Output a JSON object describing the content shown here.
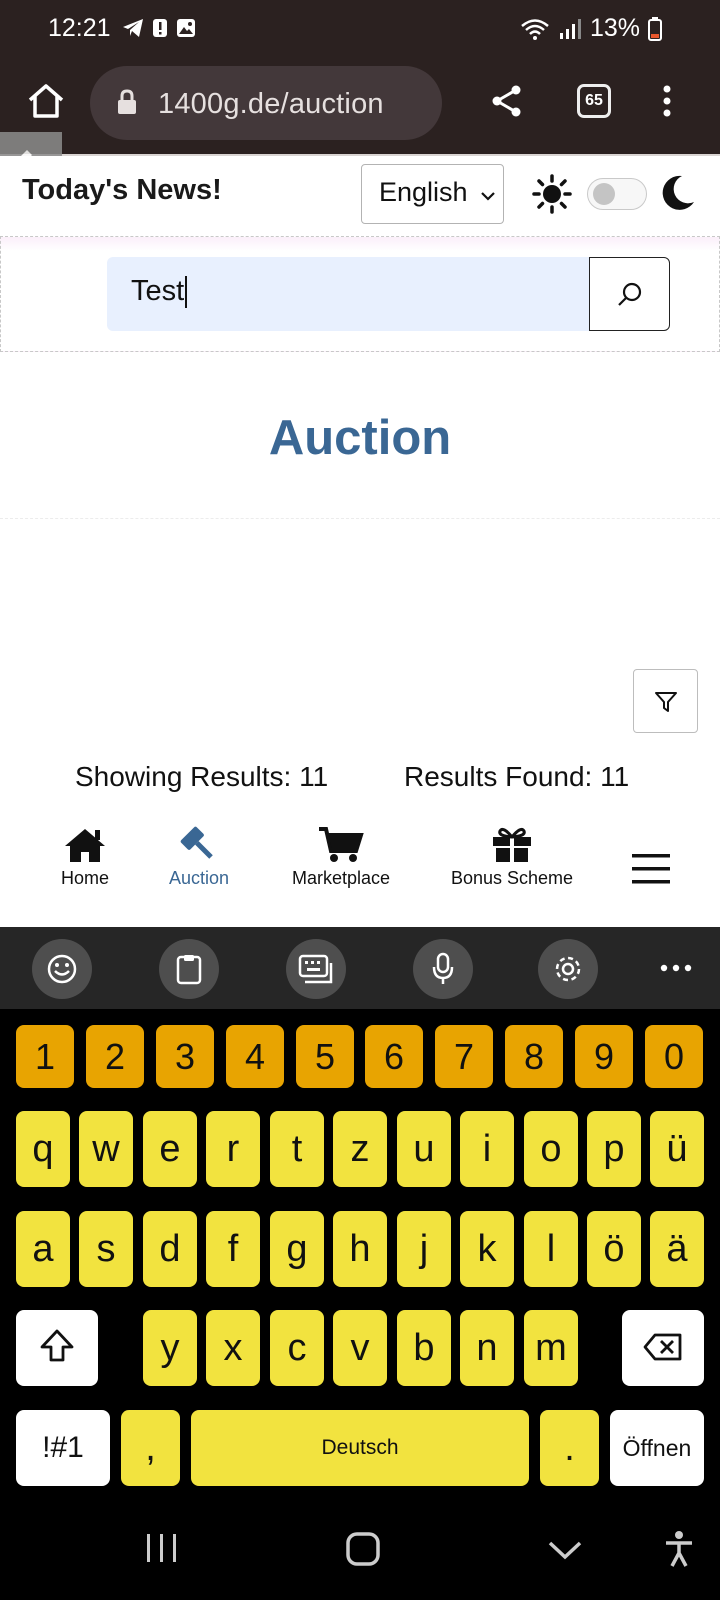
{
  "status_bar": {
    "time": "12:21",
    "battery": "13%"
  },
  "browser": {
    "url": "1400g.de/auction",
    "tab_count": "65"
  },
  "header": {
    "title": "Today's News!",
    "language": "English"
  },
  "search": {
    "value": "Test"
  },
  "page": {
    "title": "Auction"
  },
  "results": {
    "showing": "Showing Results: 11",
    "found": "Results Found: 11"
  },
  "nav": {
    "items": [
      {
        "label": "Home",
        "icon": "home-icon"
      },
      {
        "label": "Auction",
        "icon": "gavel-icon",
        "active": true
      },
      {
        "label": "Marketplace",
        "icon": "cart-icon"
      },
      {
        "label": "Bonus Scheme",
        "icon": "gift-icon"
      }
    ],
    "menu_icon": "hamburger-icon"
  },
  "keyboard": {
    "toolbar_icons": [
      "emoji-icon",
      "clipboard-icon",
      "keyboard-icon",
      "mic-icon",
      "settings-icon",
      "more-icon"
    ],
    "row_numbers": [
      "1",
      "2",
      "3",
      "4",
      "5",
      "6",
      "7",
      "8",
      "9",
      "0"
    ],
    "row1": [
      "q",
      "w",
      "e",
      "r",
      "t",
      "z",
      "u",
      "i",
      "o",
      "p",
      "ü"
    ],
    "row2": [
      "a",
      "s",
      "d",
      "f",
      "g",
      "h",
      "j",
      "k",
      "l",
      "ö",
      "ä"
    ],
    "row3": [
      "y",
      "x",
      "c",
      "v",
      "b",
      "n",
      "m"
    ],
    "symbols_label": "!#1",
    "comma": ",",
    "space_label": "Deutsch",
    "period": ".",
    "enter_label": "Öffnen"
  },
  "colors": {
    "accent": "#3a6794",
    "key_yellow": "#f2e33f",
    "key_orange": "#e8a401",
    "status_bg": "#2b2120"
  }
}
